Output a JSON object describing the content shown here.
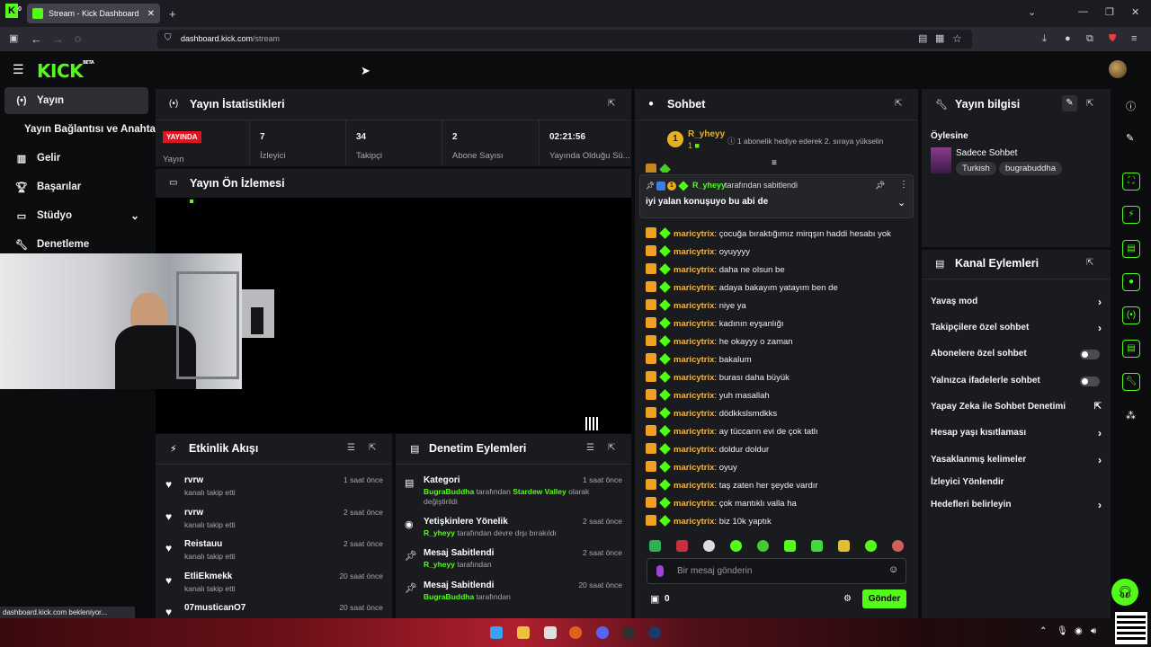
{
  "browser": {
    "ext_badge": "0",
    "tab_title": "Stream - Kick Dashboard",
    "url_host": "dashboard.kick.com",
    "url_path": "/stream",
    "status_text": "dashboard.kick.com bekleniyor..."
  },
  "brand": {
    "logo": "KICK",
    "beta": "BETA",
    "accent": "#53fc18"
  },
  "nav": {
    "items": [
      {
        "label": "Yayın",
        "icon": "broadcast-icon"
      },
      {
        "label": "Yayın Bağlantısı ve Anahtarı",
        "icon": ""
      },
      {
        "label": "Gelir",
        "icon": "chart-icon"
      },
      {
        "label": "Başarılar",
        "icon": "trophy-icon"
      },
      {
        "label": "Stüdyo",
        "icon": "studio-icon"
      },
      {
        "label": "Denetleme",
        "icon": "wrench-icon"
      }
    ]
  },
  "stats": {
    "title": "Yayın İstatistikleri",
    "live_badge": "YAYINDA",
    "live_label": "Yayın",
    "items": [
      {
        "value": "7",
        "label": "İzleyici"
      },
      {
        "value": "34",
        "label": "Takipçi"
      },
      {
        "value": "2",
        "label": "Abone Sayısı"
      },
      {
        "value": "02:21:56",
        "label": "Yayında Olduğu Sü..."
      }
    ]
  },
  "preview": {
    "title": "Yayın Ön İzlemesi"
  },
  "activity": {
    "title": "Etkinlik Akışı",
    "items": [
      {
        "name": "rvrw",
        "action": "kanalı takip etti",
        "time": "1 saat önce"
      },
      {
        "name": "rvrw",
        "action": "kanalı takip etti",
        "time": "2 saat önce"
      },
      {
        "name": "Reistauu",
        "action": "kanalı takip etti",
        "time": "2 saat önce"
      },
      {
        "name": "EtliEkmekk",
        "action": "kanalı takip etti",
        "time": "20 saat önce"
      },
      {
        "name": "07musticanO7",
        "action": "",
        "time": "20 saat önce"
      }
    ]
  },
  "moderation": {
    "title": "Denetim Eylemleri",
    "items": [
      {
        "title": "Kategori",
        "actor": "BugraBuddha",
        "mid": " tarafından ",
        "target": "Stardew Valley",
        "tail": " olarak değiştirildi",
        "time": "1 saat önce"
      },
      {
        "title": "Yetişkinlere Yönelik",
        "actor": "R_yheyy",
        "mid": " tarafından devre dışı bırakıldı",
        "target": "",
        "tail": "",
        "time": "2 saat önce"
      },
      {
        "title": "Mesaj Sabitlendi",
        "actor": "R_yheyy",
        "mid": " tarafından",
        "target": "",
        "tail": "",
        "time": "2 saat önce"
      },
      {
        "title": "Mesaj Sabitlendi",
        "actor": "BugraBuddha",
        "mid": " tarafından",
        "target": "",
        "tail": "",
        "time": "20 saat önce"
      }
    ]
  },
  "chat": {
    "title": "Sohbet",
    "gifter": {
      "name": "R_yheyy",
      "rank": "1",
      "count": "1"
    },
    "gift_note": "1 abonelik hediye ederek 2. sıraya yükselin",
    "pinned": {
      "by": "R_yheyy",
      "by_suffix": " tarafından sabitlendi",
      "text": "iyi yalan konuşuyo bu abi de",
      "badge_count": "1"
    },
    "messages": [
      {
        "user": "maricytrix",
        "text": "çocuğa bıraktığımız mirqşın haddi hesabı yok"
      },
      {
        "user": "maricytrix",
        "text": "oyuyyyy"
      },
      {
        "user": "maricytrix",
        "text": "daha ne olsun be"
      },
      {
        "user": "maricytrix",
        "text": "adaya bakayım yatayım ben de"
      },
      {
        "user": "maricytrix",
        "text": "niye ya"
      },
      {
        "user": "maricytrix",
        "text": "kadının eyşanlığı"
      },
      {
        "user": "maricytrix",
        "text": "he okayyy o zaman"
      },
      {
        "user": "maricytrix",
        "text": "bakalum"
      },
      {
        "user": "maricytrix",
        "text": "burası daha büyük"
      },
      {
        "user": "maricytrix",
        "text": "yuh masallah"
      },
      {
        "user": "maricytrix",
        "text": "dödkkslsmdkks"
      },
      {
        "user": "maricytrix",
        "text": "ay tüccarın evi de çok tatlı"
      },
      {
        "user": "maricytrix",
        "text": "doldur doldur"
      },
      {
        "user": "maricytrix",
        "text": "oyuy"
      },
      {
        "user": "maricytrix",
        "text": "taş zaten her şeyde vardır"
      },
      {
        "user": "maricytrix",
        "text": "çok mantıklı valla ha"
      },
      {
        "user": "maricytrix",
        "text": "biz 10k yaptık"
      }
    ],
    "input_placeholder": "Bir mesaj gönderin",
    "points": "0",
    "send_label": "Gönder"
  },
  "stream_info": {
    "title": "Yayın bilgisi",
    "stream_title": "Öylesine",
    "category": "Sadece Sohbet",
    "tags": [
      "Turkish",
      "bugrabuddha"
    ]
  },
  "channel_actions": {
    "title": "Kanal Eylemleri",
    "items": [
      {
        "label": "Yavaş mod",
        "control": "chevron"
      },
      {
        "label": "Takipçilere özel sohbet",
        "control": "chevron"
      },
      {
        "label": "Abonelere özel sohbet",
        "control": "toggle"
      },
      {
        "label": "Yalnızca ifadelerle sohbet",
        "control": "toggle"
      },
      {
        "label": "Yapay Zeka ile Sohbet Denetimi",
        "control": "external"
      },
      {
        "label": "Hesap yaşı kısıtlaması",
        "control": "chevron"
      },
      {
        "label": "Yasaklanmış kelimeler",
        "control": "chevron"
      },
      {
        "label": "İzleyici Yönlendir",
        "control": "none"
      },
      {
        "label": "Hedefleri belirleyin",
        "control": "chevron"
      }
    ]
  }
}
